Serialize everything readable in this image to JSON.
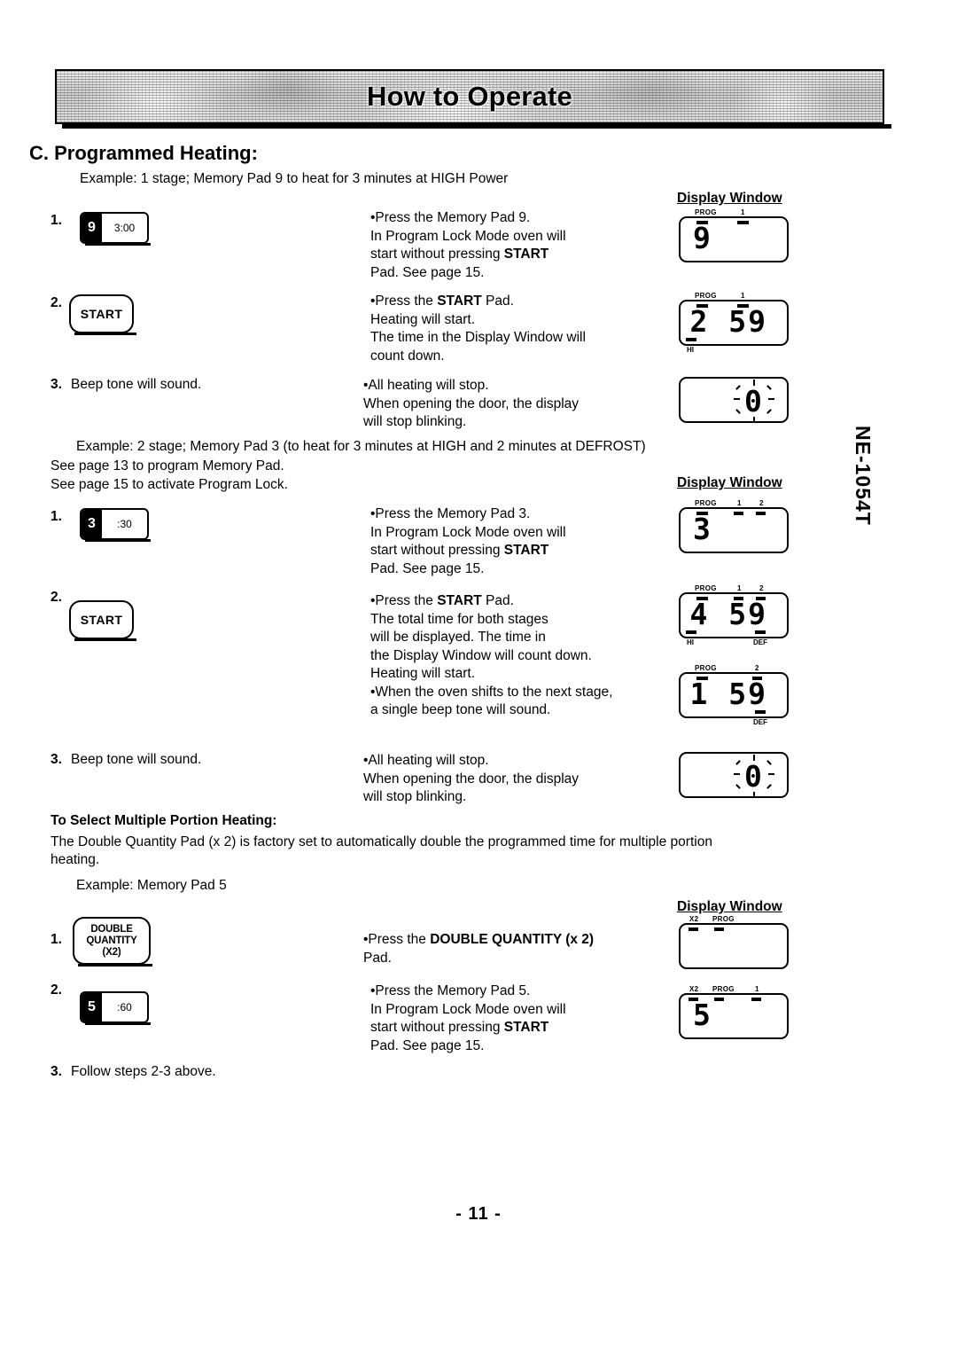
{
  "banner": {
    "title": "How to Operate"
  },
  "section": {
    "heading": "C. Programmed Heating:"
  },
  "model_side_text": "NE-1054T",
  "page_number": "- 11 -",
  "display_window_label": "Display Window",
  "example1": {
    "caption": "Example: 1 stage; Memory Pad 9 to heat for 3 minutes at HIGH Power",
    "steps": [
      {
        "number": "1.",
        "pad": {
          "type": "memory-pad",
          "digit": "9",
          "time": "3:00"
        },
        "text": "•Press the Memory Pad 9.\n In Program Lock Mode oven will\n start without pressing START\n Pad. See page 15.",
        "text_plain": "Press the Memory Pad 9. In Program Lock Mode oven will start without pressing START Pad. See page 15."
      },
      {
        "number": "2.",
        "pad": {
          "type": "start-pad",
          "label": "START"
        },
        "text": "•Press the START Pad.\n Heating will start.\n The time in the Display Window will\n count down.",
        "text_plain": "Press the START Pad. Heating will start. The time in the Display Window will count down."
      },
      {
        "number": "3.",
        "pad": {
          "type": "none",
          "label": "Beep tone will sound."
        },
        "text": "•All heating will stop.\n When opening the door, the display\n will stop blinking.",
        "text_plain": "All heating will stop. When opening the door, the display will stop blinking."
      }
    ],
    "displays": [
      {
        "digits": "9",
        "align": "left",
        "top_indicators": [
          {
            "label": "PROG",
            "x": 16
          },
          {
            "label": "1",
            "x": 66
          }
        ],
        "bottom_indicators": [],
        "blinking": false
      },
      {
        "digits": "2 59",
        "align": "right",
        "top_indicators": [
          {
            "label": "PROG",
            "x": 16
          },
          {
            "label": "1",
            "x": 66
          }
        ],
        "bottom_indicators": [
          {
            "label": "HI",
            "x": 6
          }
        ],
        "blinking": false
      },
      {
        "digits": "0",
        "align": "right",
        "top_indicators": [],
        "bottom_indicators": [],
        "blinking": true
      }
    ]
  },
  "example2": {
    "caption": "Example: 2 stage; Memory Pad 3 (to heat for 3 minutes at HIGH and 2 minutes at DEFROST)",
    "notes": [
      "See page 13 to program Memory Pad.",
      "See page 15 to activate Program Lock."
    ],
    "steps": [
      {
        "number": "1.",
        "pad": {
          "type": "memory-pad",
          "digit": "3",
          "time": ":30"
        },
        "text": "•Press the Memory Pad 3.\n In Program Lock Mode oven will\n start without pressing START\n Pad. See page 15.",
        "text_plain": "Press the Memory Pad 3. In Program Lock Mode oven will start without pressing START Pad. See page 15."
      },
      {
        "number": "2.",
        "pad": {
          "type": "start-pad",
          "label": "START"
        },
        "text": "•Press the START Pad.\n The total time for both stages\n will be displayed. The time in\n the Display Window will count down.\n Heating will start.\n•When the oven shifts to the next stage,\n a single beep tone will sound.",
        "text_plain": "Press the START Pad. The total time for both stages will be displayed. The time in the Display Window will count down. Heating will start. When the oven shifts to the next stage, a single beep tone will sound."
      },
      {
        "number": "3.",
        "pad": {
          "type": "none",
          "label": "Beep tone will sound."
        },
        "text": "•All heating will stop.\n When opening the door, the display\n will stop blinking.",
        "text_plain": "All heating will stop. When opening the door, the display will stop blinking."
      }
    ],
    "displays": [
      {
        "digits": "3",
        "align": "left",
        "top_indicators": [
          {
            "label": "PROG",
            "x": 16
          },
          {
            "label": "1",
            "x": 62
          },
          {
            "label": "2",
            "x": 86
          }
        ],
        "bottom_indicators": [],
        "blinking": false
      },
      {
        "digits": "4 59",
        "align": "right",
        "top_indicators": [
          {
            "label": "PROG",
            "x": 16
          },
          {
            "label": "1",
            "x": 62
          },
          {
            "label": "2",
            "x": 86
          }
        ],
        "bottom_indicators": [
          {
            "label": "HI",
            "x": 6
          },
          {
            "label": "DEF",
            "x": 82
          }
        ],
        "blinking": false
      },
      {
        "digits": "1 59",
        "align": "right",
        "top_indicators": [
          {
            "label": "PROG",
            "x": 16
          },
          {
            "label": "2",
            "x": 80
          }
        ],
        "bottom_indicators": [
          {
            "label": "DEF",
            "x": 82
          }
        ],
        "blinking": false
      },
      {
        "digits": "0",
        "align": "right",
        "top_indicators": [],
        "bottom_indicators": [],
        "blinking": true
      }
    ]
  },
  "multiple_portion": {
    "heading": "To Select Multiple Portion Heating:",
    "body": "The Double Quantity Pad (x 2) is factory set to automatically double the programmed time for multiple portion heating.",
    "caption": "Example: Memory Pad 5",
    "steps": [
      {
        "number": "1.",
        "pad": {
          "type": "double-quantity-pad",
          "line1": "DOUBLE",
          "line2": "QUANTITY",
          "line3": "(X2)"
        },
        "text": "•Press the DOUBLE QUANTITY (x 2)\n Pad.",
        "text_plain": "Press the DOUBLE QUANTITY (x 2) Pad."
      },
      {
        "number": "2.",
        "pad": {
          "type": "memory-pad",
          "digit": "5",
          "time": ":60"
        },
        "text": "•Press the Memory Pad 5.\n In Program Lock Mode oven will\n start without pressing START\n Pad. See page 15.",
        "text_plain": "Press the Memory Pad 5. In Program Lock Mode oven will start without pressing START Pad. See page 15."
      },
      {
        "number": "3.",
        "pad": {
          "type": "none",
          "label": "Follow steps 2-3 above."
        },
        "text": "",
        "text_plain": ""
      }
    ],
    "displays": [
      {
        "digits": "",
        "align": "left",
        "top_indicators": [
          {
            "label": "X2",
            "x": 10
          },
          {
            "label": "PROG",
            "x": 36
          }
        ],
        "bottom_indicators": [],
        "blinking": false
      },
      {
        "digits": "5",
        "align": "left",
        "top_indicators": [
          {
            "label": "X2",
            "x": 10
          },
          {
            "label": "PROG",
            "x": 36
          },
          {
            "label": "1",
            "x": 82
          }
        ],
        "bottom_indicators": [],
        "blinking": false
      }
    ]
  }
}
